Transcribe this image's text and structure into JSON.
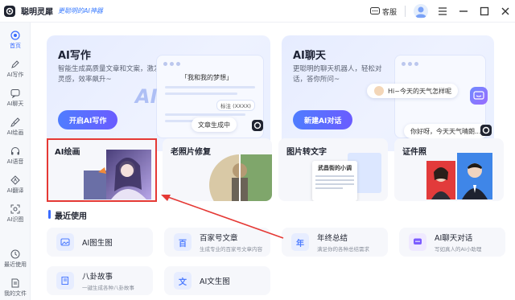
{
  "app": {
    "title": "聪明灵犀",
    "subtitle": "更聪明的AI神器",
    "service_label": "客服"
  },
  "sidebar": {
    "items": [
      {
        "label": "首页",
        "icon": "home-icon",
        "active": true
      },
      {
        "label": "AI写作",
        "icon": "pen-icon"
      },
      {
        "label": "AI聊天",
        "icon": "chat-icon"
      },
      {
        "label": "AI绘画",
        "icon": "brush-icon"
      },
      {
        "label": "AI语音",
        "icon": "headphones-icon"
      },
      {
        "label": "AI翻译",
        "icon": "translate-icon"
      },
      {
        "label": "AI识图",
        "icon": "scan-icon"
      },
      {
        "label": "最近使用",
        "icon": "clock-icon"
      },
      {
        "label": "我的文件",
        "icon": "file-icon"
      }
    ]
  },
  "cards": {
    "write": {
      "title": "AI写作",
      "desc": "智能生成高质量文章和文案，激发灵感，效率飙升~",
      "button": "开启AI写作",
      "board_title": "「我和我的梦想」",
      "tag": "标注 (XXXX)",
      "gen": "文章生成中",
      "badge": "AI"
    },
    "chat": {
      "title": "AI聊天",
      "desc": "更聪明的聊天机器人，轻松对话，答你所问~",
      "button": "新建AI对话",
      "q": "Hi~今天的天气怎样呢",
      "a": "你好呀，今天天气晴朗..."
    }
  },
  "tools": [
    {
      "name": "AI绘画"
    },
    {
      "name": "老照片修复"
    },
    {
      "name": "图片转文字",
      "doc_title": "武昌街的小调"
    },
    {
      "name": "证件照"
    }
  ],
  "recent": {
    "title": "最近使用",
    "items": [
      {
        "name": "AI图生图",
        "desc": "",
        "icon": "image-icon",
        "color": "#4f7dff"
      },
      {
        "name": "百家号文章",
        "desc": "生成专业的百家号文章内容",
        "icon": "baijia-icon",
        "glyph": "百",
        "color": "#4f7dff"
      },
      {
        "name": "年终总结",
        "desc": "满足你的各种总结需求",
        "icon": "year-icon",
        "glyph": "年",
        "color": "#4f7dff"
      },
      {
        "name": "AI聊天对话",
        "desc": "写如真人的AI小助理",
        "icon": "chat-bubble-icon",
        "color": "#7b5cff"
      },
      {
        "name": "八卦故事",
        "desc": "一键生成各种八卦故事",
        "icon": "book-icon",
        "color": "#4f7dff"
      },
      {
        "name": "AI文生图",
        "desc": "",
        "icon": "text-image-icon",
        "glyph": "文",
        "color": "#4f7dff"
      }
    ]
  },
  "colors": {
    "accent": "#3b6cff",
    "highlight": "#e53935"
  }
}
